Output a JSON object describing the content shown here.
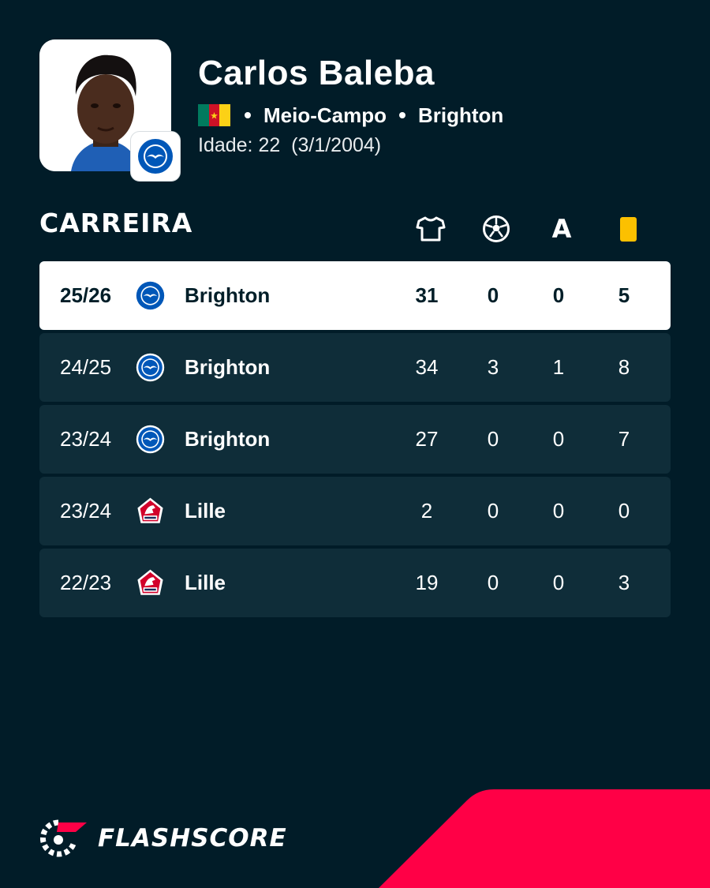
{
  "player": {
    "name": "Carlos Baleba",
    "position": "Meio-Campo",
    "club": "Brighton",
    "age_line": "Idade: 22  (3/1/2004)"
  },
  "flag_icon": "cameroon-flag-icon",
  "section_title": "CARREIRA",
  "columns": {
    "apps_icon": "shirt-icon",
    "goals_icon": "football-icon",
    "assists_label": "A",
    "cards_icon": "yellow-card-icon"
  },
  "career": [
    {
      "season": "25/26",
      "team": "Brighton",
      "logo": "brighton-logo-icon",
      "apps": "31",
      "goals": "0",
      "assists": "0",
      "cards": "5"
    },
    {
      "season": "24/25",
      "team": "Brighton",
      "logo": "brighton-logo-icon",
      "apps": "34",
      "goals": "3",
      "assists": "1",
      "cards": "8"
    },
    {
      "season": "23/24",
      "team": "Brighton",
      "logo": "brighton-logo-icon",
      "apps": "27",
      "goals": "0",
      "assists": "0",
      "cards": "7"
    },
    {
      "season": "23/24",
      "team": "Lille",
      "logo": "lille-logo-icon",
      "apps": "2",
      "goals": "0",
      "assists": "0",
      "cards": "0"
    },
    {
      "season": "22/23",
      "team": "Lille",
      "logo": "lille-logo-icon",
      "apps": "19",
      "goals": "0",
      "assists": "0",
      "cards": "3"
    }
  ],
  "brand": {
    "name": "FLASHSCORE"
  },
  "colors": {
    "background": "#011c28",
    "row": "#0f2d39",
    "accent": "#ff0046",
    "yellow_card": "#fcc000"
  }
}
